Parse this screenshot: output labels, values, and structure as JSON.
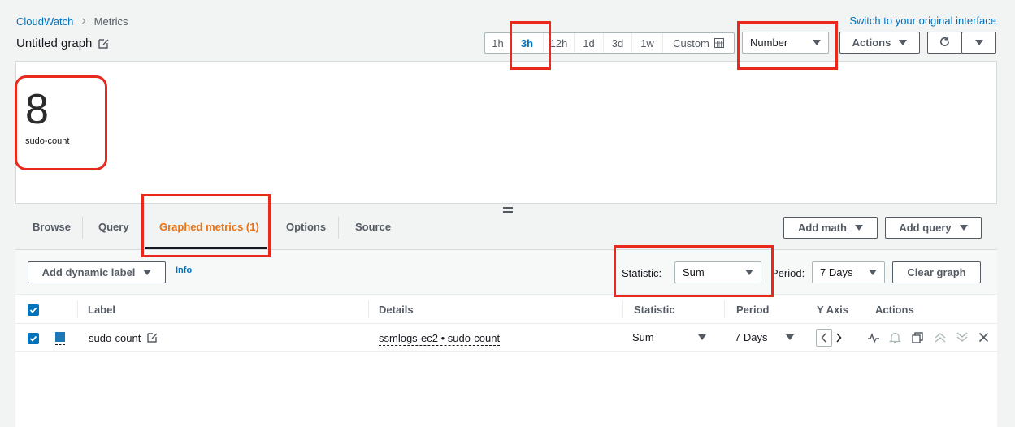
{
  "breadcrumb": {
    "root": "CloudWatch",
    "current": "Metrics"
  },
  "switch_link": "Switch to your original interface",
  "graph_title": "Untitled graph",
  "time_ranges": [
    "1h",
    "3h",
    "12h",
    "1d",
    "3d",
    "1w"
  ],
  "time_active": "3h",
  "custom_label": "Custom",
  "widget_type": "Number",
  "actions_label": "Actions",
  "number_widget": {
    "value": "8",
    "label": "sudo-count"
  },
  "tabs": {
    "browse": "Browse",
    "query": "Query",
    "graphed": "Graphed metrics (1)",
    "options": "Options",
    "source": "Source"
  },
  "add_math": "Add math",
  "add_query": "Add query",
  "add_dynamic_label": "Add dynamic label",
  "info": "Info",
  "statistic_label": "Statistic:",
  "statistic_value": "Sum",
  "period_label": "Period:",
  "period_value": "7 Days",
  "clear_graph": "Clear graph",
  "table": {
    "headers": {
      "label": "Label",
      "details": "Details",
      "statistic": "Statistic",
      "period": "Period",
      "yaxis": "Y Axis",
      "actions": "Actions"
    },
    "rows": [
      {
        "label": "sudo-count",
        "details": "ssmlogs-ec2 • sudo-count",
        "statistic": "Sum",
        "period": "7 Days",
        "color": "#1f77b4"
      }
    ]
  },
  "colors": {
    "accent": "#0073bb",
    "active_tab": "#ec7211",
    "highlight": "#e8291c"
  }
}
